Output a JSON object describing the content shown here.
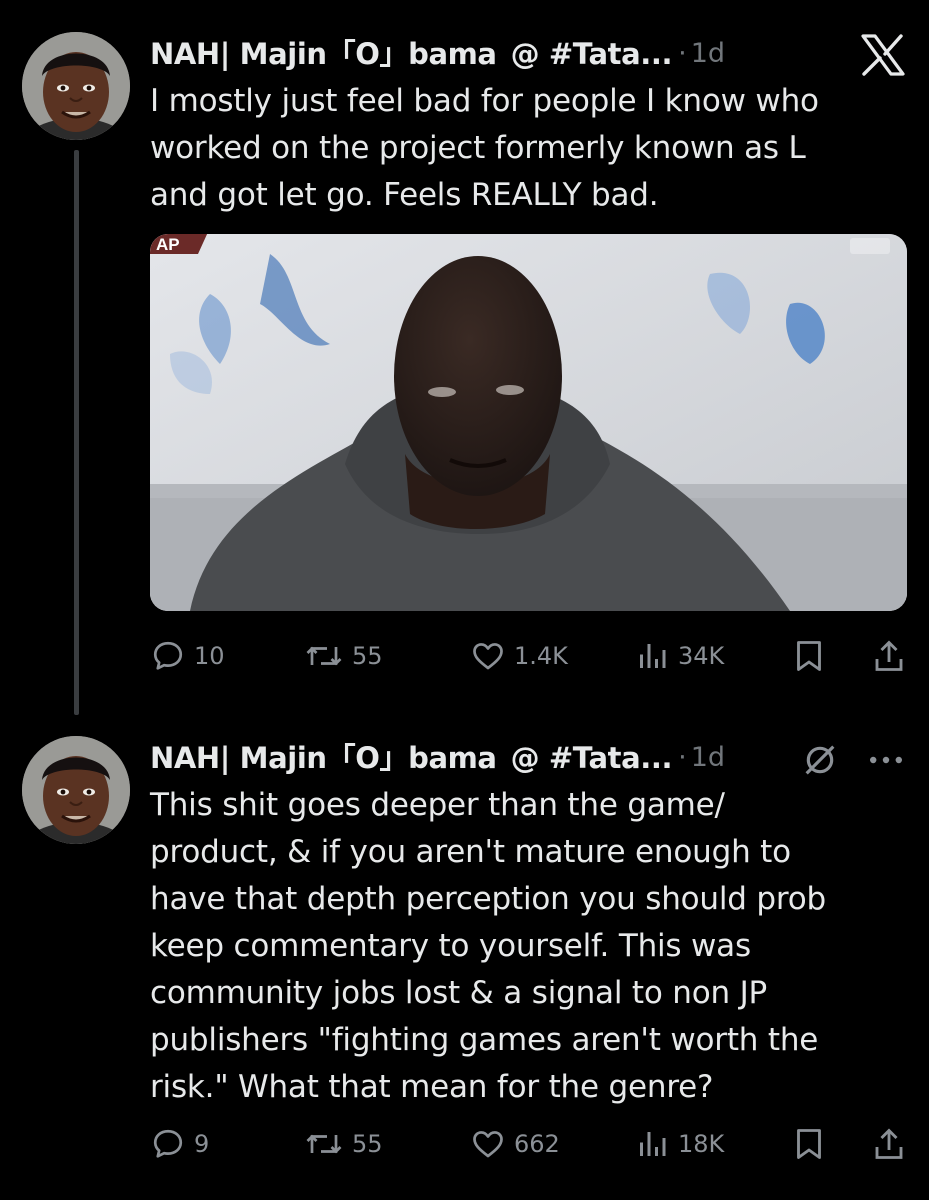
{
  "tweets": [
    {
      "display_name": "NAH| Majin「O」bama",
      "handle": "@ #Tata...",
      "separator": "·",
      "time": "1d",
      "text": "I mostly just feel bad for people I know who\nworked on the project formerly known as L\nand got let go. Feels REALLY bad.",
      "media_badge": "AP",
      "stats": {
        "replies": "10",
        "reposts": "55",
        "likes": "1.4K",
        "views": "34K"
      }
    },
    {
      "display_name": "NAH| Majin「O」bama",
      "handle": "@ #Tata...",
      "separator": "·",
      "time": "1d",
      "text": "This shit goes deeper than the game/\nproduct, & if you aren't mature enough to\nhave that depth perception you should prob\nkeep commentary to yourself. This was\ncommunity jobs lost & a signal to non JP\npublishers \"fighting games aren't worth the\nrisk.\" What that mean for the genre?",
      "stats": {
        "replies": "9",
        "reposts": "55",
        "likes": "662",
        "views": "18K"
      }
    }
  ],
  "icons": {
    "app_logo": "x-logo-icon",
    "reply": "reply-icon",
    "repost": "repost-icon",
    "like": "heart-icon",
    "views": "views-icon",
    "bookmark": "bookmark-icon",
    "share": "share-icon",
    "muted": "mute-icon",
    "more": "more-icon"
  },
  "colors": {
    "background": "#000000",
    "text": "#e7e9ea",
    "secondary_text": "#71767b",
    "thread_line": "#3a3d40"
  }
}
